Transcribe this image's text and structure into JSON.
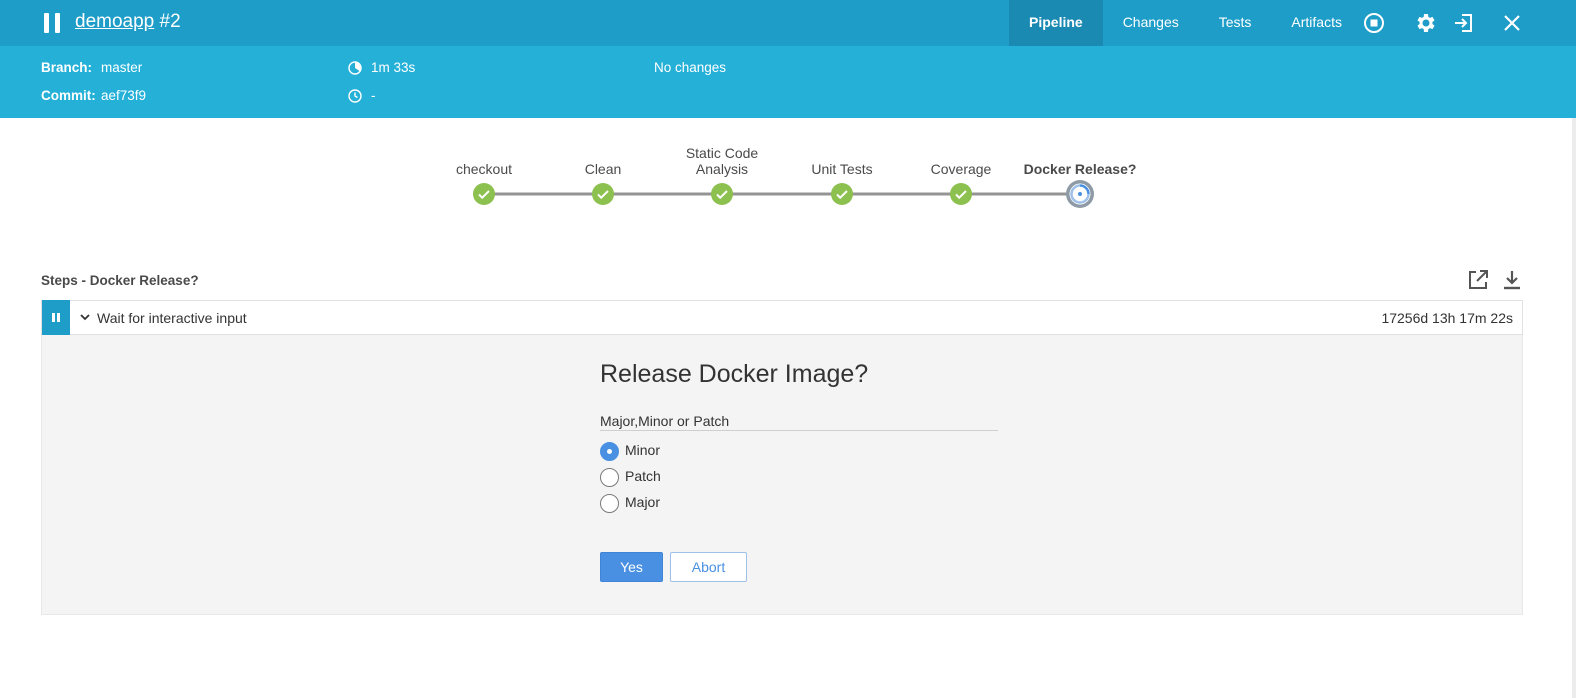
{
  "header": {
    "app_name": "demoapp",
    "run_number": "#2",
    "tabs": [
      {
        "label": "Pipeline",
        "active": true
      },
      {
        "label": "Changes",
        "active": false
      },
      {
        "label": "Tests",
        "active": false
      },
      {
        "label": "Artifacts",
        "active": false
      }
    ],
    "icons": [
      "stop-icon",
      "gear-icon",
      "exit-icon",
      "close-icon"
    ]
  },
  "info": {
    "branch_label": "Branch:",
    "branch": "master",
    "commit_label": "Commit:",
    "commit": "aef73f9",
    "duration": "1m 33s",
    "ended": "-",
    "changes": "No changes"
  },
  "pipeline": {
    "stages": [
      {
        "line1": "checkout",
        "line2": "",
        "status": "success"
      },
      {
        "line1": "Clean",
        "line2": "",
        "status": "success"
      },
      {
        "line1": "Static Code",
        "line2": "Analysis",
        "status": "success"
      },
      {
        "line1": "Unit Tests",
        "line2": "",
        "status": "success"
      },
      {
        "line1": "Coverage",
        "line2": "",
        "status": "success"
      },
      {
        "line1": "Docker Release?",
        "line2": "",
        "status": "paused"
      }
    ]
  },
  "steps": {
    "title": "Steps - Docker Release?",
    "step_name": "Wait for interactive input",
    "step_duration": "17256d 13h 17m 22s"
  },
  "input_form": {
    "title": "Release Docker Image?",
    "param_label": "Major,Minor or Patch",
    "options": [
      {
        "label": "Minor",
        "checked": true
      },
      {
        "label": "Patch",
        "checked": false
      },
      {
        "label": "Major",
        "checked": false
      }
    ],
    "yes_label": "Yes",
    "abort_label": "Abort"
  },
  "colors": {
    "header_bg": "#1d9dc8",
    "infobar_bg": "#25b0d8",
    "success": "#8cc04f",
    "accent": "#4a90e2"
  }
}
